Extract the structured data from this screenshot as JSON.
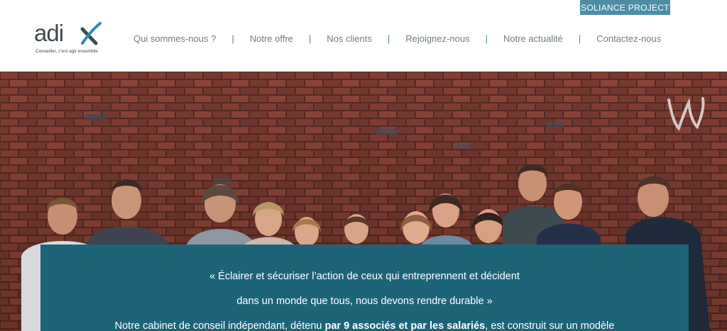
{
  "header": {
    "top_link": "SOLIANCE PROJECT",
    "logo": {
      "word": "adi",
      "tagline": "Conseiller, c'est agir ensemble"
    },
    "nav": [
      {
        "label": "Qui sommes-nous ?"
      },
      {
        "label": "Notre offre"
      },
      {
        "label": "Nos clients"
      },
      {
        "label": "Rejoignez-nous"
      },
      {
        "label": "Notre actualité"
      },
      {
        "label": "Contactez-nous"
      }
    ],
    "separator": "|"
  },
  "hero": {
    "quote_line_1": "« Éclairer et sécuriser l’action de ceux qui entreprennent et décident",
    "quote_line_2": "dans un monde que tous, nous devons rendre durable »",
    "intro_before": "Notre cabinet de conseil indépendant, détenu ",
    "intro_bold": "par 9 associés et par les salariés",
    "intro_after": ", est construit sur un modèle"
  },
  "colors": {
    "accent": "#4e8ea5",
    "panel": "#1e6478",
    "nav_text": "#6e7d85",
    "logo_text": "#3f4a4f"
  },
  "icons": {
    "logo_mark": "check-x-icon",
    "watermark": "signature-watermark-icon"
  }
}
